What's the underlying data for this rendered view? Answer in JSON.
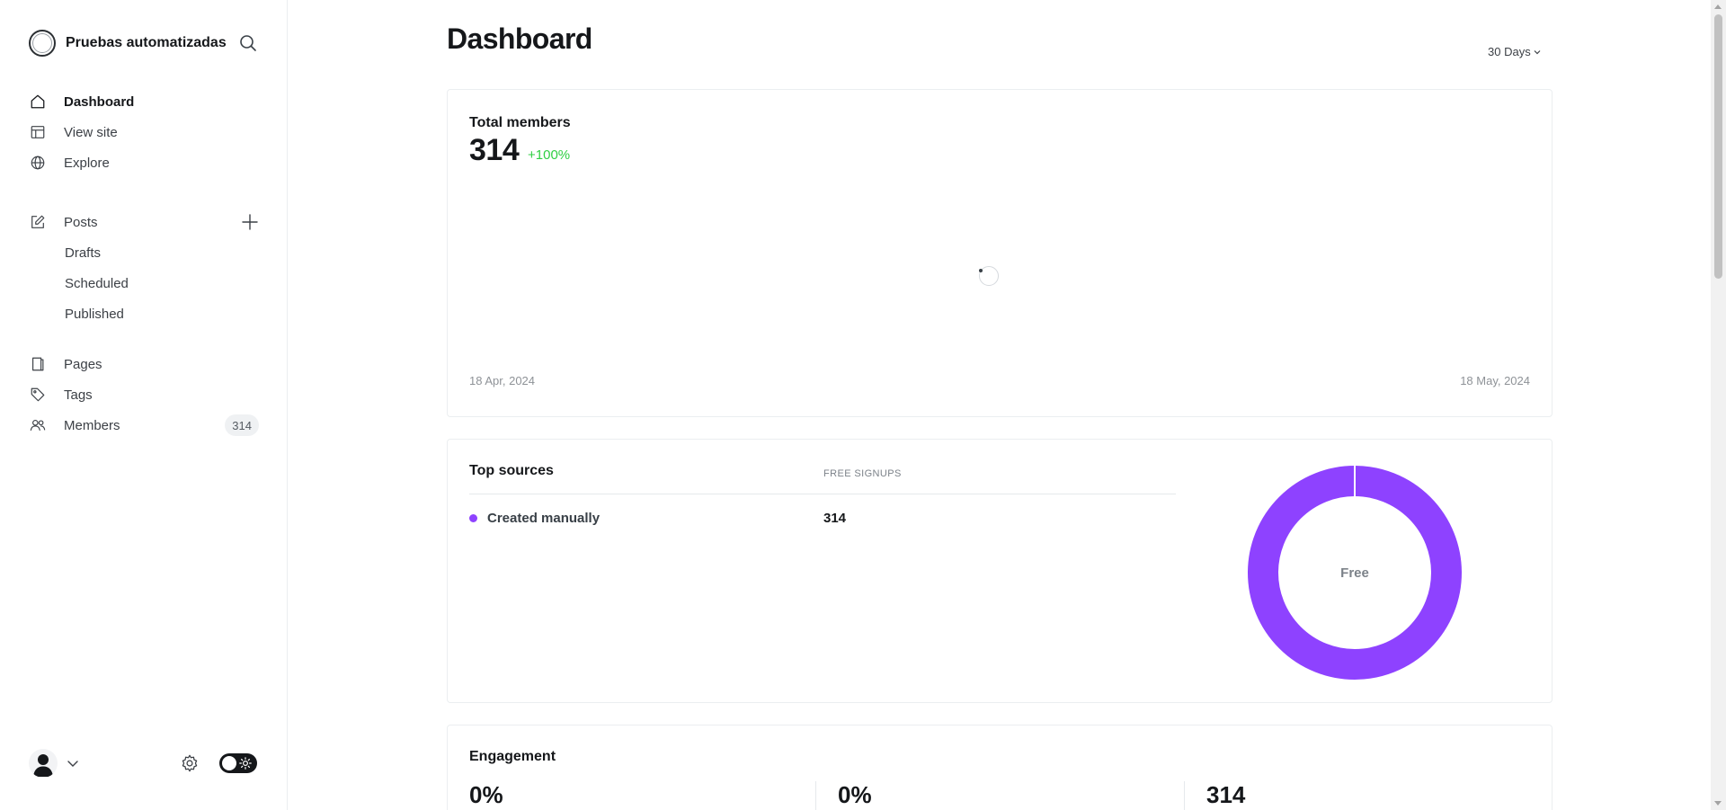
{
  "brand": {
    "name": "Pruebas automatizadas",
    "logo_icon": "site-logo-icon",
    "search_icon": "search-icon"
  },
  "nav": {
    "primary": [
      {
        "label": "Dashboard",
        "icon": "home-icon",
        "active": true
      },
      {
        "label": "View site",
        "icon": "layout-icon"
      },
      {
        "label": "Explore",
        "icon": "globe-icon"
      }
    ],
    "posts": {
      "label": "Posts",
      "icon": "edit-icon",
      "add_icon": "plus-icon",
      "children": [
        {
          "label": "Drafts"
        },
        {
          "label": "Scheduled"
        },
        {
          "label": "Published"
        }
      ]
    },
    "secondary": [
      {
        "label": "Pages",
        "icon": "pages-icon"
      },
      {
        "label": "Tags",
        "icon": "tag-icon"
      },
      {
        "label": "Members",
        "icon": "members-icon",
        "count": "314"
      }
    ]
  },
  "footer": {
    "avatar_icon": "user-avatar-icon",
    "chevron_icon": "chevron-down-icon",
    "settings_icon": "gear-icon",
    "theme_toggle_icon": "sun-icon"
  },
  "header": {
    "title": "Dashboard",
    "range": "30 Days"
  },
  "members_card": {
    "label": "Total members",
    "value": "314",
    "trend": "+100%",
    "date_start": "18 Apr, 2024",
    "date_end": "18 May, 2024"
  },
  "sources_card": {
    "title": "Top sources",
    "column": "FREE SIGNUPS",
    "rows": [
      {
        "name": "Created manually",
        "value": "314",
        "color": "#8e42ff"
      }
    ],
    "donut_label": "Free"
  },
  "engagement_card": {
    "title": "Engagement",
    "values": [
      "0%",
      "0%",
      "314"
    ]
  },
  "colors": {
    "accent": "#8e42ff",
    "positive": "#30cf43",
    "text": "#15171a"
  }
}
